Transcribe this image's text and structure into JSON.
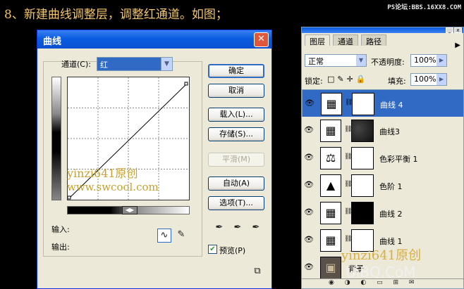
{
  "caption": "8、新建曲线调整层，调整红通道。如图；",
  "site": "PS论坛:BBS.16XX8.COM",
  "watermarks": {
    "author": "yinzi641原创",
    "site": "www.swcool.com",
    "panel_author": "yinzi641原创",
    "panel_site": "UiBQ.CoM"
  },
  "dialog": {
    "title": "曲线",
    "close": "✕",
    "channel_label": "通道(C):",
    "channel_value": "红",
    "input_label": "输入:",
    "output_label": "输出:",
    "buttons": {
      "ok": "确定",
      "cancel": "取消",
      "load": "载入(L)...",
      "save": "存储(S)...",
      "smooth": "平滑(M)",
      "auto": "自动(A)",
      "options": "选项(T)..."
    },
    "preview_label": "预览(P)",
    "preview_checked": true,
    "slider_glyph": "◀▶"
  },
  "layers_panel": {
    "tabs": [
      "图层",
      "通道",
      "路径"
    ],
    "blend_mode": "正常",
    "opacity_label": "不透明度:",
    "opacity": "100%",
    "lock_label": "锁定:",
    "fill_label": "填充:",
    "fill": "100%",
    "layers": [
      {
        "name": "曲线 4",
        "selected": true,
        "icon": "curves-icon",
        "mask": "white"
      },
      {
        "name": "曲线3",
        "selected": false,
        "icon": "curves-icon",
        "mask": "noise"
      },
      {
        "name": "色彩平衡 1",
        "selected": false,
        "icon": "color-balance-icon",
        "mask": "white"
      },
      {
        "name": "色阶 1",
        "selected": false,
        "icon": "levels-icon",
        "mask": "white"
      },
      {
        "name": "曲线 2",
        "selected": false,
        "icon": "curves-icon",
        "mask": "black"
      },
      {
        "name": "曲线 1",
        "selected": false,
        "icon": "curves-icon",
        "mask": "white"
      },
      {
        "name": "背景",
        "selected": false,
        "icon": "photo-icon",
        "mask": "none"
      }
    ]
  }
}
